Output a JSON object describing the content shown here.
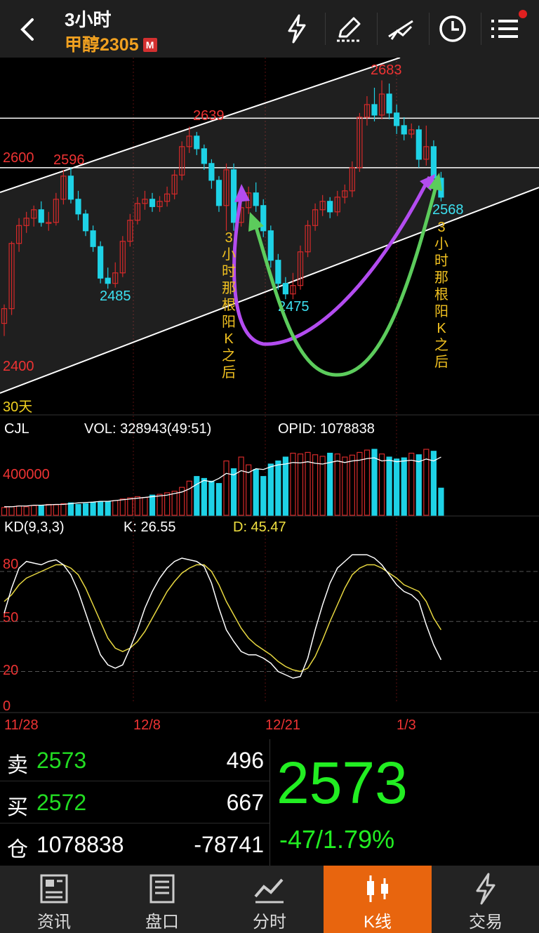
{
  "header": {
    "period": "3小时",
    "symbol": "甲醇2305",
    "badge": "M",
    "icons": [
      "lightning-icon",
      "pen-draw-icon",
      "line-tool-icon",
      "clock-icon",
      "menu-list-icon"
    ]
  },
  "chart_data": {
    "type": "candlestick",
    "price_axis": {
      "ticks": [
        2400,
        2600
      ],
      "min": 2365,
      "max": 2700
    },
    "price_labels": {
      "high1": "2596",
      "high2": "2639",
      "high3": "2683",
      "low1": "2485",
      "low2": "2475",
      "last_low": "2568",
      "tick_2600": "2600",
      "tick_2400": "2400"
    },
    "horizontal_levels": [
      2600,
      2647
    ],
    "period_label": "30天",
    "annotation_1": [
      "3",
      "小",
      "时",
      "那",
      "根",
      "阳",
      "K",
      "之",
      "后"
    ],
    "annotation_2": [
      "3",
      "小",
      "时",
      "那",
      "根",
      "阳",
      "K",
      "之",
      "后"
    ],
    "candles": [
      [
        2452,
        2466,
        2440,
        2470
      ],
      [
        2466,
        2528,
        2460,
        2530
      ],
      [
        2528,
        2545,
        2520,
        2552
      ],
      [
        2545,
        2552,
        2538,
        2558
      ],
      [
        2552,
        2560,
        2544,
        2564
      ],
      [
        2560,
        2548,
        2544,
        2568
      ],
      [
        2548,
        2548,
        2540,
        2558
      ],
      [
        2548,
        2570,
        2545,
        2576
      ],
      [
        2570,
        2592,
        2565,
        2598
      ],
      [
        2592,
        2570,
        2566,
        2600
      ],
      [
        2570,
        2556,
        2550,
        2578
      ],
      [
        2556,
        2540,
        2535,
        2560
      ],
      [
        2540,
        2525,
        2520,
        2545
      ],
      [
        2525,
        2495,
        2490,
        2530
      ],
      [
        2495,
        2490,
        2485,
        2505
      ],
      [
        2490,
        2500,
        2486,
        2510
      ],
      [
        2500,
        2530,
        2496,
        2535
      ],
      [
        2530,
        2550,
        2525,
        2556
      ],
      [
        2550,
        2566,
        2546,
        2572
      ],
      [
        2566,
        2570,
        2560,
        2578
      ],
      [
        2570,
        2563,
        2558,
        2576
      ],
      [
        2563,
        2568,
        2558,
        2573
      ],
      [
        2568,
        2575,
        2563,
        2582
      ],
      [
        2575,
        2593,
        2570,
        2598
      ],
      [
        2593,
        2620,
        2588,
        2625
      ],
      [
        2620,
        2630,
        2614,
        2639
      ],
      [
        2630,
        2618,
        2612,
        2634
      ],
      [
        2618,
        2604,
        2598,
        2622
      ],
      [
        2604,
        2588,
        2580,
        2608
      ],
      [
        2588,
        2564,
        2558,
        2592
      ],
      [
        2564,
        2598,
        2540,
        2604
      ],
      [
        2598,
        2548,
        2540,
        2604
      ],
      [
        2548,
        2562,
        2544,
        2572
      ],
      [
        2562,
        2576,
        2556,
        2582
      ],
      [
        2576,
        2564,
        2558,
        2586
      ],
      [
        2564,
        2540,
        2534,
        2570
      ],
      [
        2540,
        2512,
        2505,
        2545
      ],
      [
        2512,
        2490,
        2484,
        2518
      ],
      [
        2490,
        2480,
        2475,
        2496
      ],
      [
        2480,
        2488,
        2475,
        2500
      ],
      [
        2488,
        2520,
        2484,
        2526
      ],
      [
        2520,
        2545,
        2515,
        2550
      ],
      [
        2545,
        2560,
        2540,
        2566
      ],
      [
        2560,
        2568,
        2554,
        2574
      ],
      [
        2568,
        2558,
        2552,
        2572
      ],
      [
        2558,
        2572,
        2554,
        2578
      ],
      [
        2572,
        2578,
        2566,
        2584
      ],
      [
        2578,
        2600,
        2572,
        2606
      ],
      [
        2600,
        2648,
        2596,
        2652
      ],
      [
        2648,
        2660,
        2640,
        2668
      ],
      [
        2660,
        2650,
        2644,
        2676
      ],
      [
        2650,
        2670,
        2646,
        2683
      ],
      [
        2670,
        2652,
        2646,
        2680
      ],
      [
        2652,
        2640,
        2632,
        2660
      ],
      [
        2640,
        2632,
        2626,
        2648
      ],
      [
        2632,
        2636,
        2628,
        2642
      ],
      [
        2636,
        2608,
        2600,
        2640
      ],
      [
        2608,
        2620,
        2602,
        2640
      ],
      [
        2620,
        2590,
        2584,
        2626
      ],
      [
        2590,
        2572,
        2568,
        2596
      ]
    ],
    "x_labels": [
      "11/28",
      "12/8",
      "12/21",
      "1/3"
    ],
    "volume": {
      "label": "CJL",
      "vol_text": "VOL: 328943(49:51)",
      "opid_text": "OPID: 1078838",
      "axis_label": "400000",
      "bars": [
        20,
        22,
        24,
        22,
        25,
        26,
        28,
        27,
        30,
        32,
        28,
        30,
        33,
        35,
        36,
        38,
        42,
        45,
        48,
        46,
        52,
        54,
        58,
        62,
        72,
        88,
        100,
        95,
        88,
        82,
        140,
        120,
        150,
        130,
        118,
        100,
        132,
        140,
        150,
        160,
        158,
        162,
        156,
        152,
        160,
        158,
        150,
        155,
        162,
        168,
        170,
        158,
        150,
        145,
        148,
        160,
        156,
        170,
        165,
        70
      ],
      "oi": [
        22,
        22,
        24,
        24,
        26,
        26,
        27,
        28,
        28,
        30,
        32,
        33,
        34,
        36,
        36,
        38,
        40,
        42,
        44,
        46,
        48,
        50,
        52,
        56,
        60,
        68,
        80,
        90,
        86,
        95,
        108,
        104,
        115,
        110,
        120,
        118,
        125,
        130,
        132,
        136,
        135,
        138,
        134,
        132,
        136,
        140,
        136,
        140,
        142,
        146,
        148,
        140,
        142,
        138,
        140,
        142,
        138,
        145,
        140,
        150
      ]
    },
    "kd": {
      "label": "KD(9,3,3)",
      "k_text": "K: 26.55",
      "d_text": "D: 45.47",
      "axis_ticks": [
        "80",
        "50",
        "20",
        "0"
      ],
      "k": [
        55,
        70,
        82,
        86,
        85,
        84,
        86,
        87,
        84,
        78,
        68,
        55,
        42,
        30,
        24,
        22,
        24,
        34,
        45,
        58,
        68,
        76,
        82,
        86,
        88,
        87,
        86,
        83,
        73,
        58,
        45,
        38,
        32,
        30,
        30,
        28,
        25,
        20,
        18,
        16,
        17,
        28,
        45,
        60,
        73,
        82,
        86,
        90,
        90,
        90,
        88,
        84,
        78,
        72,
        68,
        66,
        62,
        48,
        36,
        27
      ],
      "d": [
        62,
        66,
        72,
        76,
        78,
        80,
        82,
        84,
        84,
        82,
        78,
        70,
        60,
        50,
        40,
        34,
        32,
        34,
        38,
        44,
        52,
        60,
        68,
        74,
        79,
        82,
        84,
        84,
        80,
        72,
        62,
        54,
        46,
        40,
        36,
        33,
        30,
        26,
        23,
        21,
        20,
        22,
        29,
        39,
        50,
        60,
        70,
        78,
        82,
        84,
        84,
        82,
        79,
        76,
        72,
        70,
        68,
        62,
        52,
        45
      ]
    }
  },
  "quote": {
    "sell_label": "卖",
    "sell_price": "2573",
    "sell_qty": "496",
    "buy_label": "买",
    "buy_price": "2572",
    "buy_qty": "667",
    "oi_label": "仓",
    "oi_value": "1078838",
    "oi_change": "-78741",
    "last_price": "2573",
    "change": "-47/1.79%",
    "colors": {
      "up": "#d42a2a",
      "down": "#1ed2e6",
      "green": "#22ee22"
    }
  },
  "nav": {
    "items": [
      "资讯",
      "盘口",
      "分时",
      "K线",
      "交易"
    ],
    "active": 3
  }
}
